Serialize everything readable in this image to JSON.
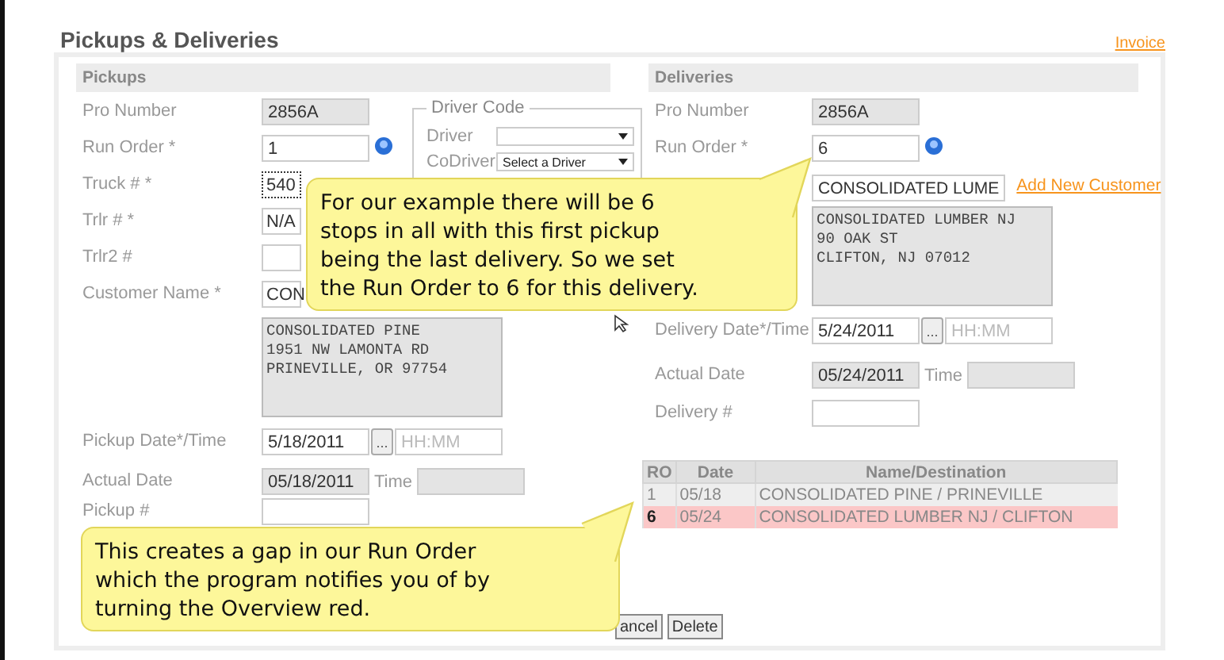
{
  "page_title": "Pickups & Deliveries",
  "invoice_link": "Invoice",
  "pickups": {
    "header": "Pickups",
    "fields": [
      {
        "kind": "readonly",
        "label": "Pro Number",
        "value": "2856A"
      },
      {
        "kind": "info",
        "label": "Run Order *",
        "value": "1"
      },
      {
        "kind": "text",
        "label": "Truck # *",
        "value": "540",
        "focused": true
      },
      {
        "kind": "text",
        "label": "Trlr # *",
        "value": "N/A",
        "focused": false
      },
      {
        "kind": "text",
        "label": "Trlr2 #",
        "focused": false
      },
      {
        "kind": "text",
        "label": "Customer Name *",
        "value": "CON",
        "focused": false
      },
      {
        "kind": "address",
        "lines": [
          "CONSOLIDATED PINE",
          "1951 NW LAMONTA RD",
          "PRINEVILLE, OR 97754"
        ]
      },
      {
        "kind": "date",
        "label": "Pickup Date*/Time",
        "value": "5/18/2011",
        "button": "...",
        "placeholder": "HH:MM"
      },
      {
        "kind": "actual",
        "label": "Actual Date",
        "value": "05/18/2011",
        "time_label": "Time"
      },
      {
        "kind": "text",
        "label": "Pickup #",
        "focused": false
      }
    ],
    "driver_code": {
      "legend": "Driver Code",
      "selects": [
        {
          "label": "Driver"
        },
        {
          "label": "CoDriver",
          "value": "Select a Driver"
        }
      ]
    }
  },
  "deliveries": {
    "header": "Deliveries",
    "fields": [
      {
        "kind": "readonly",
        "label": "Pro Number",
        "value": "2856A"
      },
      {
        "kind": "info",
        "label": "Run Order *",
        "value": "6"
      },
      {
        "kind": "customer",
        "value": "CONSOLIDATED LUME",
        "link": "Add New Customer"
      },
      {
        "kind": "address",
        "lines": [
          "CONSOLIDATED LUMBER NJ",
          "90 OAK ST",
          "CLIFTON, NJ 07012"
        ]
      },
      {
        "kind": "date",
        "label": "Delivery Date*/Time",
        "value": "5/24/2011",
        "button": "...",
        "placeholder": "HH:MM"
      },
      {
        "kind": "actual",
        "label": "Actual Date",
        "value": "05/24/2011",
        "time_label": "Time"
      },
      {
        "kind": "text",
        "label": "Delivery #",
        "focused": false
      }
    ]
  },
  "overview": {
    "columns": [
      "RO",
      "Date",
      "Name/Destination"
    ],
    "rows": [
      {
        "ro": "1",
        "date": "05/18",
        "name": "CONSOLIDATED PINE / PRINEVILLE",
        "gap": false
      },
      {
        "ro": "6",
        "date": "05/24",
        "name": "CONSOLIDATED LUMBER NJ / CLIFTON",
        "gap": true
      }
    ]
  },
  "buttons": [
    "ancel",
    "Delete"
  ],
  "callouts": [
    {
      "text": "For our example there will be 6\nstops in all with this first pickup\nbeing the last delivery. So we set\nthe Run Order to 6 for this delivery."
    },
    {
      "text": "This creates a gap in our Run Order\nwhich the program notifies you of by\nturning the Overview red."
    }
  ]
}
